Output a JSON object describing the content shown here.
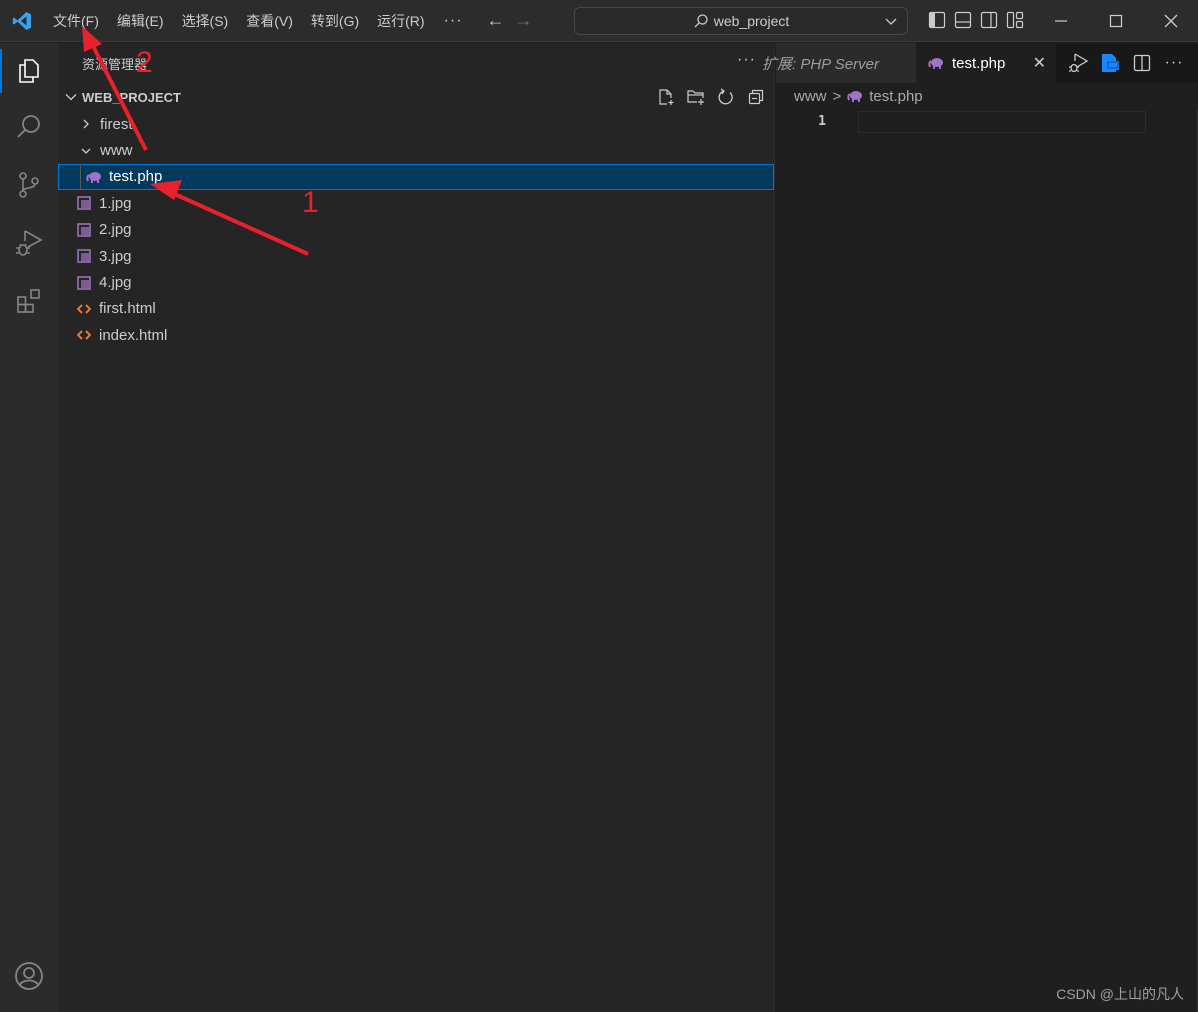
{
  "titlebar": {
    "menu": [
      "文件(F)",
      "编辑(E)",
      "选择(S)",
      "查看(V)",
      "转到(G)",
      "运行(R)"
    ],
    "more": "···",
    "search_text": "web_project",
    "nav_back": "←",
    "nav_forward": "→"
  },
  "activitybar": {
    "items": [
      "explorer",
      "search",
      "source-control",
      "run-and-debug",
      "extensions"
    ],
    "bottom": [
      "accounts"
    ]
  },
  "sidebar": {
    "title": "资源管理器",
    "more": "···",
    "section_title": "WEB_PROJECT",
    "tree": [
      {
        "label": "firest",
        "type": "folder",
        "expanded": false,
        "depth": 0
      },
      {
        "label": "www",
        "type": "folder",
        "expanded": true,
        "depth": 0
      },
      {
        "label": "test.php",
        "type": "php",
        "depth": 1,
        "selected": true
      },
      {
        "label": "1.jpg",
        "type": "image",
        "depth": 0
      },
      {
        "label": "2.jpg",
        "type": "image",
        "depth": 0
      },
      {
        "label": "3.jpg",
        "type": "image",
        "depth": 0
      },
      {
        "label": "4.jpg",
        "type": "image",
        "depth": 0
      },
      {
        "label": "first.html",
        "type": "html",
        "depth": 0
      },
      {
        "label": "index.html",
        "type": "html",
        "depth": 0
      }
    ]
  },
  "editor": {
    "tabs": [
      {
        "label": "扩展: PHP Server",
        "active": false
      },
      {
        "label": "test.php",
        "active": true,
        "close": "✕"
      }
    ],
    "breadcrumb": [
      "www",
      "test.php"
    ],
    "breadcrumb_sep": ">",
    "lines": [
      "1"
    ]
  },
  "annotations": {
    "labels": [
      "1",
      "2"
    ],
    "color": "#e8212b"
  },
  "watermark": "CSDN @上山的凡人",
  "colors": {
    "accent": "#0078d4",
    "selection": "#04395e",
    "php_icon": "#a074c4",
    "html_icon": "#e37933"
  }
}
